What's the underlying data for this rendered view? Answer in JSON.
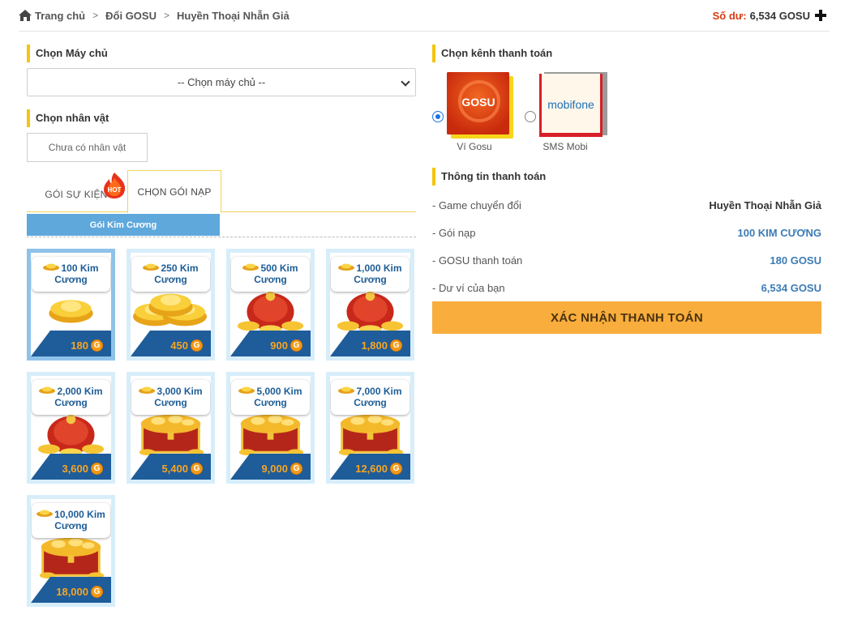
{
  "breadcrumb": {
    "home": "Trang chủ",
    "level2": "Đổi GOSU",
    "current": "Huyền Thoại Nhẫn Giả"
  },
  "balance": {
    "label": "Số dư:",
    "value": "6,534 GOSU"
  },
  "server": {
    "heading": "Chọn Máy chủ",
    "selected": "-- Chọn máy chủ --"
  },
  "character": {
    "heading": "Chọn nhân vật",
    "placeholder": "Chưa có nhân vật"
  },
  "tabs": {
    "event": "GÓI SỰ KIỆN",
    "hot_badge": "HOT",
    "topup": "CHỌN GÓI NẠP",
    "subtab": "Gói Kim Cương"
  },
  "packages": [
    {
      "name": "100 Kim Cương",
      "price": "180",
      "selected": true
    },
    {
      "name": "250 Kim Cương",
      "price": "450"
    },
    {
      "name": "500 Kim Cương",
      "price": "900"
    },
    {
      "name": "1,000 Kim Cương",
      "price": "1,800"
    },
    {
      "name": "2,000 Kim Cương",
      "price": "3,600"
    },
    {
      "name": "3,000 Kim Cương",
      "price": "5,400"
    },
    {
      "name": "5,000 Kim Cương",
      "price": "9,000"
    },
    {
      "name": "7,000 Kim Cương",
      "price": "12,600"
    },
    {
      "name": "10,000 Kim Cương",
      "price": "18,000"
    }
  ],
  "payment": {
    "heading": "Chọn kênh thanh toán",
    "channels": [
      {
        "name": "Ví Gosu",
        "logo": "GOSU",
        "selected": true
      },
      {
        "name": "SMS Mobi",
        "logo": "mobifone",
        "selected": false
      }
    ]
  },
  "info": {
    "heading": "Thông tin thanh toán",
    "rows": [
      {
        "label": "- Game chuyển đổi",
        "value": "Huyền Thoại Nhẫn Giả"
      },
      {
        "label": "- Gói nạp",
        "value": "100 KIM CƯƠNG"
      },
      {
        "label": "- GOSU thanh toán",
        "value": "180 GOSU"
      },
      {
        "label": "- Dư ví của bạn",
        "value": "6,534 GOSU"
      }
    ],
    "confirm": "XÁC NHẬN THANH TOÁN"
  },
  "colors": {
    "accent_yellow": "#f4c40f",
    "confirm_bg": "#f9ad3c",
    "tab_blue": "#5ea8dc",
    "price_orange": "#f6a623",
    "value_blue": "#3c7cb5",
    "balance_red": "#d83b12"
  }
}
